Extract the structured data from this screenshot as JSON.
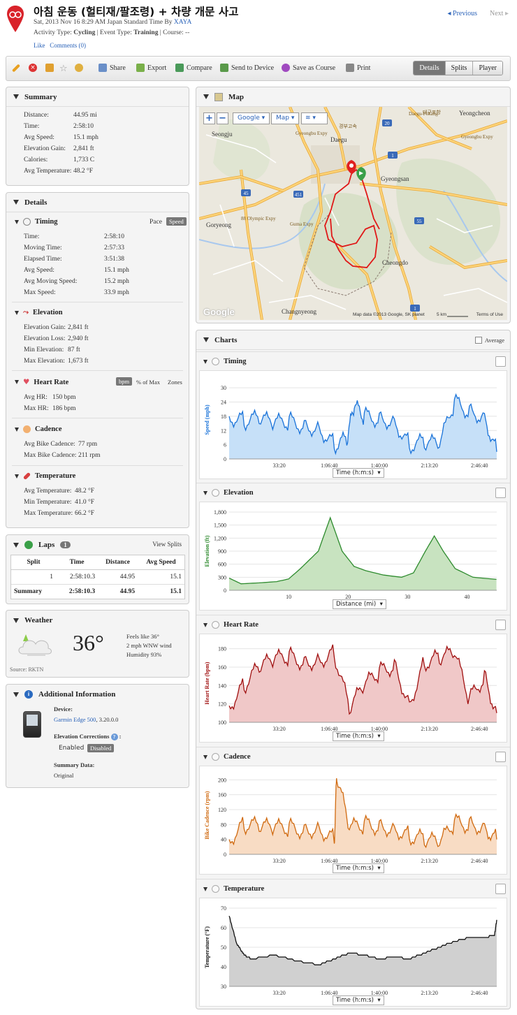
{
  "header": {
    "title": "아침 운동 (헐티재/팔조령) + 차량 개문 사고",
    "meta_date": "Sat, 2013 Nov 16 8:29 AM Japan Standard Time By ",
    "meta_user": "XAYA",
    "meta_type_label": "Activity Type: ",
    "meta_type": "Cycling",
    "meta_event_label": " | Event Type: ",
    "meta_event": "Training",
    "meta_course": " | Course: --",
    "like": "Like",
    "comments": "Comments (0)",
    "previous": "Previous",
    "next": "Next"
  },
  "toolbar": {
    "share": "Share",
    "export": "Export",
    "compare": "Compare",
    "send": "Send to Device",
    "save_course": "Save as Course",
    "print": "Print",
    "tab_details": "Details",
    "tab_splits": "Splits",
    "tab_player": "Player"
  },
  "summary": {
    "title": "Summary",
    "rows": [
      [
        "Distance:",
        "44.95 mi"
      ],
      [
        "Time:",
        "2:58:10"
      ],
      [
        "Avg Speed:",
        "15.1 mph"
      ],
      [
        "Elevation Gain:",
        "2,841 ft"
      ],
      [
        "Calories:",
        "1,733 C"
      ],
      [
        "Avg Temperature:",
        "48.2 °F"
      ]
    ]
  },
  "details": {
    "title": "Details",
    "timing": {
      "title": "Timing",
      "pace": "Pace",
      "speed": "Speed",
      "rows": [
        [
          "Time:",
          "2:58:10"
        ],
        [
          "Moving Time:",
          "2:57:33"
        ],
        [
          "Elapsed Time:",
          "3:51:38"
        ],
        [
          "Avg Speed:",
          "15.1 mph"
        ],
        [
          "Avg Moving Speed:",
          "15.2 mph"
        ],
        [
          "Max Speed:",
          "33.9 mph"
        ]
      ]
    },
    "elevation": {
      "title": "Elevation",
      "rows": [
        [
          "Elevation Gain:",
          "2,841 ft"
        ],
        [
          "Elevation Loss:",
          "2,940 ft"
        ],
        [
          "Min Elevation:",
          "87 ft"
        ],
        [
          "Max Elevation:",
          "1,673 ft"
        ]
      ]
    },
    "heart": {
      "title": "Heart Rate",
      "bpm": "bpm",
      "pct": "% of Max",
      "zones": "Zones",
      "rows": [
        [
          "Avg HR:",
          "150 bpm"
        ],
        [
          "Max HR:",
          "186 bpm"
        ]
      ]
    },
    "cadence": {
      "title": "Cadence",
      "rows": [
        [
          "Avg Bike Cadence:",
          "77 rpm"
        ],
        [
          "Max Bike Cadence:",
          "211 rpm"
        ]
      ]
    },
    "temperature": {
      "title": "Temperature",
      "rows": [
        [
          "Avg Temperature:",
          "48.2 °F"
        ],
        [
          "Min Temperature:",
          "41.0 °F"
        ],
        [
          "Max Temperature:",
          "66.2 °F"
        ]
      ]
    }
  },
  "laps": {
    "title": "Laps",
    "count": "1",
    "view_splits": "View Splits",
    "headers": [
      "Split",
      "Time",
      "Distance",
      "Avg Speed"
    ],
    "rows": [
      [
        "1",
        "2:58:10.3",
        "44.95",
        "15.1"
      ]
    ],
    "summary": [
      "Summary",
      "2:58:10.3",
      "44.95",
      "15.1"
    ]
  },
  "weather": {
    "title": "Weather",
    "temp": "36°",
    "feels": "Feels like 36°",
    "wind": "2 mph WNW wind",
    "humidity": "Humidity 93%",
    "source": "Source: RKTN"
  },
  "additional": {
    "title": "Additional Information",
    "device_label": "Device:",
    "device": "Garmin Edge 500",
    "device_ver": ", 3.20.0.0",
    "elev_corr": "Elevation Corrections",
    "enabled": "Enabled",
    "disabled": "Disabled",
    "summary_label": "Summary Data:",
    "summary_val": "Original"
  },
  "map": {
    "title": "Map",
    "google": "Google",
    "maptype": "Map",
    "places": [
      "Seongju",
      "Daegu",
      "Gyeongsan",
      "Goryeong",
      "Cheongdo",
      "Changnyeong",
      "Yeongcheon",
      "Daegu-Pohang",
      "Gyeongbu Expy",
      "88 Olympic Expy",
      "Guma Expy",
      "경부고속",
      "Gyeongbu Expy",
      "대구포항",
      "45",
      "20",
      "1",
      "55",
      "451",
      "88",
      "55",
      "1"
    ],
    "copyright": "Map data ©2013 Google, SK planet",
    "scale": "5 km",
    "terms": "Terms of Use"
  },
  "charts": {
    "title": "Charts",
    "average": "Average",
    "timing": {
      "title": "Timing",
      "ylabel": "Speed (mph)",
      "axis": "Time (h:m:s)",
      "yticks": [
        "30",
        "24",
        "18",
        "12",
        "6",
        "0"
      ],
      "xticks": [
        "33:20",
        "1:06:40",
        "1:40:00",
        "2:13:20",
        "2:46:40"
      ]
    },
    "elevation": {
      "title": "Elevation",
      "ylabel": "Elevation (ft)",
      "axis": "Distance (mi)",
      "yticks": [
        "1,800",
        "1,500",
        "1,200",
        "900",
        "600",
        "300",
        "0"
      ],
      "xticks": [
        "10",
        "20",
        "30",
        "40"
      ]
    },
    "heart": {
      "title": "Heart Rate",
      "ylabel": "Heart Rate (bpm)",
      "axis": "Time (h:m:s)",
      "yticks": [
        "180",
        "160",
        "140",
        "120",
        "100"
      ],
      "xticks": [
        "33:20",
        "1:06:40",
        "1:40:00",
        "2:13:20",
        "2:46:40"
      ]
    },
    "cadence": {
      "title": "Cadence",
      "ylabel": "Bike Cadence (rpm)",
      "axis": "Time (h:m:s)",
      "yticks": [
        "200",
        "160",
        "120",
        "80",
        "40",
        "0"
      ],
      "xticks": [
        "33:20",
        "1:06:40",
        "1:40:00",
        "2:13:20",
        "2:46:40"
      ]
    },
    "temperature": {
      "title": "Temperature",
      "ylabel": "Temperature (°F)",
      "axis": "Time (h:m:s)",
      "yticks": [
        "70",
        "60",
        "50",
        "40",
        "30"
      ],
      "xticks": [
        "33:20",
        "1:06:40",
        "1:40:00",
        "2:13:20",
        "2:46:40"
      ]
    }
  },
  "colors": {
    "speed": "#1a73d9",
    "elev": "#2e8b2e",
    "hr": "#a01010",
    "cad": "#d06a10",
    "temp": "#111111"
  },
  "chart_data": [
    {
      "type": "area",
      "title": "Timing",
      "ylabel": "Speed (mph)",
      "xlabel": "Time (h:m:s)",
      "ylim": [
        0,
        33
      ],
      "x_seconds": [
        0,
        600,
        1200,
        1800,
        2400,
        3000,
        3600,
        4200,
        4700,
        5000,
        5400,
        6000,
        6600,
        7200,
        7800,
        8400,
        9000,
        9600,
        10200,
        10690
      ],
      "y": [
        18,
        16,
        17,
        15,
        16,
        14,
        13,
        6,
        8,
        22,
        18,
        17,
        16,
        6,
        7,
        6,
        24,
        20,
        18,
        3
      ]
    },
    {
      "type": "area",
      "title": "Elevation",
      "ylabel": "Elevation (ft)",
      "xlabel": "Distance (mi)",
      "ylim": [
        0,
        1800
      ],
      "x": [
        0,
        2,
        5,
        8,
        10,
        12,
        15,
        17,
        19,
        21,
        23,
        26,
        29,
        31,
        33,
        34.5,
        36,
        38,
        41,
        44.95
      ],
      "y": [
        280,
        150,
        170,
        200,
        260,
        500,
        900,
        1670,
        900,
        550,
        450,
        350,
        300,
        400,
        900,
        1250,
        900,
        500,
        300,
        250
      ]
    },
    {
      "type": "area",
      "title": "Heart Rate",
      "ylabel": "Heart Rate (bpm)",
      "xlabel": "Time (h:m:s)",
      "ylim": [
        100,
        185
      ],
      "x_seconds": [
        0,
        600,
        1200,
        1800,
        2400,
        3000,
        3600,
        4200,
        4800,
        5400,
        6000,
        6600,
        7200,
        7800,
        8400,
        9000,
        9600,
        10200,
        10690
      ],
      "y": [
        118,
        140,
        160,
        168,
        172,
        165,
        168,
        175,
        115,
        140,
        155,
        162,
        120,
        165,
        170,
        175,
        125,
        150,
        110
      ]
    },
    {
      "type": "area",
      "title": "Cadence",
      "ylabel": "Bike Cadence (rpm)",
      "xlabel": "Time (h:m:s)",
      "ylim": [
        0,
        210
      ],
      "x_seconds": [
        0,
        600,
        1200,
        1800,
        2400,
        3000,
        3600,
        4200,
        4300,
        4800,
        5400,
        6000,
        6600,
        7200,
        7800,
        8400,
        9000,
        9600,
        10200,
        10690
      ],
      "y": [
        40,
        80,
        75,
        70,
        72,
        65,
        70,
        40,
        211,
        70,
        80,
        75,
        70,
        50,
        40,
        30,
        85,
        80,
        75,
        40
      ]
    },
    {
      "type": "area",
      "title": "Temperature",
      "ylabel": "Temperature (°F)",
      "xlabel": "Time (h:m:s)",
      "ylim": [
        30,
        70
      ],
      "x_seconds": [
        0,
        300,
        600,
        900,
        1800,
        2700,
        3600,
        4200,
        4800,
        5400,
        6000,
        6600,
        7200,
        7800,
        8400,
        9000,
        9600,
        10200,
        10600,
        10690
      ],
      "y": [
        66,
        52,
        46,
        44,
        46,
        43,
        41,
        44,
        47,
        46,
        44,
        45,
        44,
        47,
        50,
        53,
        55,
        55,
        56,
        64
      ]
    }
  ]
}
